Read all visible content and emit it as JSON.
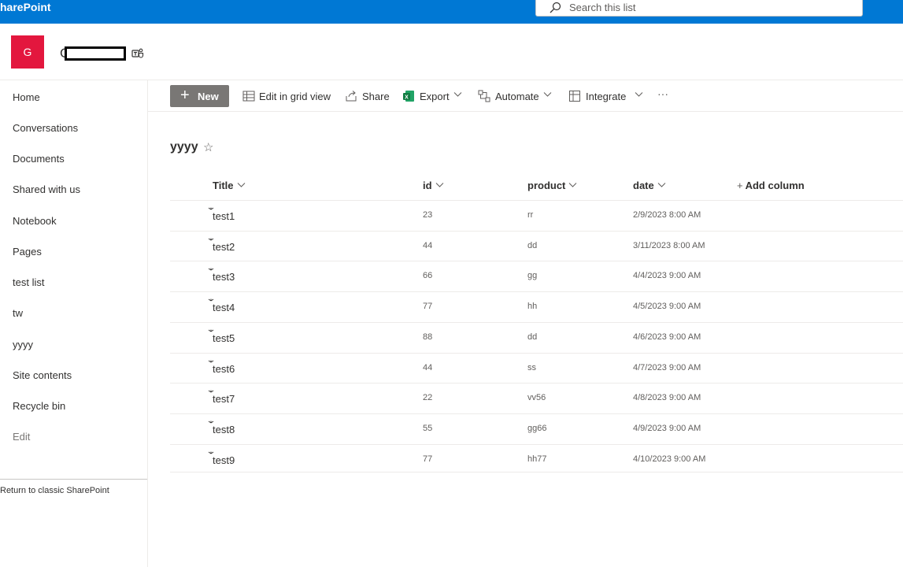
{
  "suitebar": {
    "app_name": "harePoint",
    "search_placeholder": "Search this list"
  },
  "site": {
    "logo_letter": "G",
    "title": "G"
  },
  "leftnav": {
    "items": [
      {
        "label": "Home"
      },
      {
        "label": "Conversations"
      },
      {
        "label": "Documents"
      },
      {
        "label": "Shared with us"
      },
      {
        "label": "Notebook"
      },
      {
        "label": "Pages"
      },
      {
        "label": "test list"
      },
      {
        "label": "tw"
      },
      {
        "label": "yyyy"
      },
      {
        "label": "Site contents"
      },
      {
        "label": "Recycle bin"
      }
    ],
    "edit_label": "Edit",
    "classic_label": "Return to classic SharePoint"
  },
  "commandbar": {
    "new_label": "New",
    "grid_label": "Edit in grid view",
    "share_label": "Share",
    "export_label": "Export",
    "automate_label": "Automate",
    "integrate_label": "Integrate",
    "more_label": "···"
  },
  "list": {
    "title": "yyyy",
    "columns": {
      "title": "Title",
      "id": "id",
      "product": "product",
      "date": "date",
      "add": "Add column"
    },
    "rows": [
      {
        "title": "test1",
        "id": "23",
        "product": "rr",
        "date": "2/9/2023 8:00 AM"
      },
      {
        "title": "test2",
        "id": "44",
        "product": "dd",
        "date": "3/11/2023 8:00 AM"
      },
      {
        "title": "test3",
        "id": "66",
        "product": "gg",
        "date": "4/4/2023 9:00 AM"
      },
      {
        "title": "test4",
        "id": "77",
        "product": "hh",
        "date": "4/5/2023 9:00 AM"
      },
      {
        "title": "test5",
        "id": "88",
        "product": "dd",
        "date": "4/6/2023 9:00 AM"
      },
      {
        "title": "test6",
        "id": "44",
        "product": "ss",
        "date": "4/7/2023 9:00 AM"
      },
      {
        "title": "test7",
        "id": "22",
        "product": "vv56",
        "date": "4/8/2023 9:00 AM"
      },
      {
        "title": "test8",
        "id": "55",
        "product": "gg66",
        "date": "4/9/2023 9:00 AM"
      },
      {
        "title": "test9",
        "id": "77",
        "product": "hh77",
        "date": "4/10/2023 9:00 AM"
      }
    ]
  },
  "colors": {
    "suitebar": "#0078d4",
    "site_logo": "#e3173e",
    "new_button": "#797775",
    "excel_green": "#107c41"
  }
}
